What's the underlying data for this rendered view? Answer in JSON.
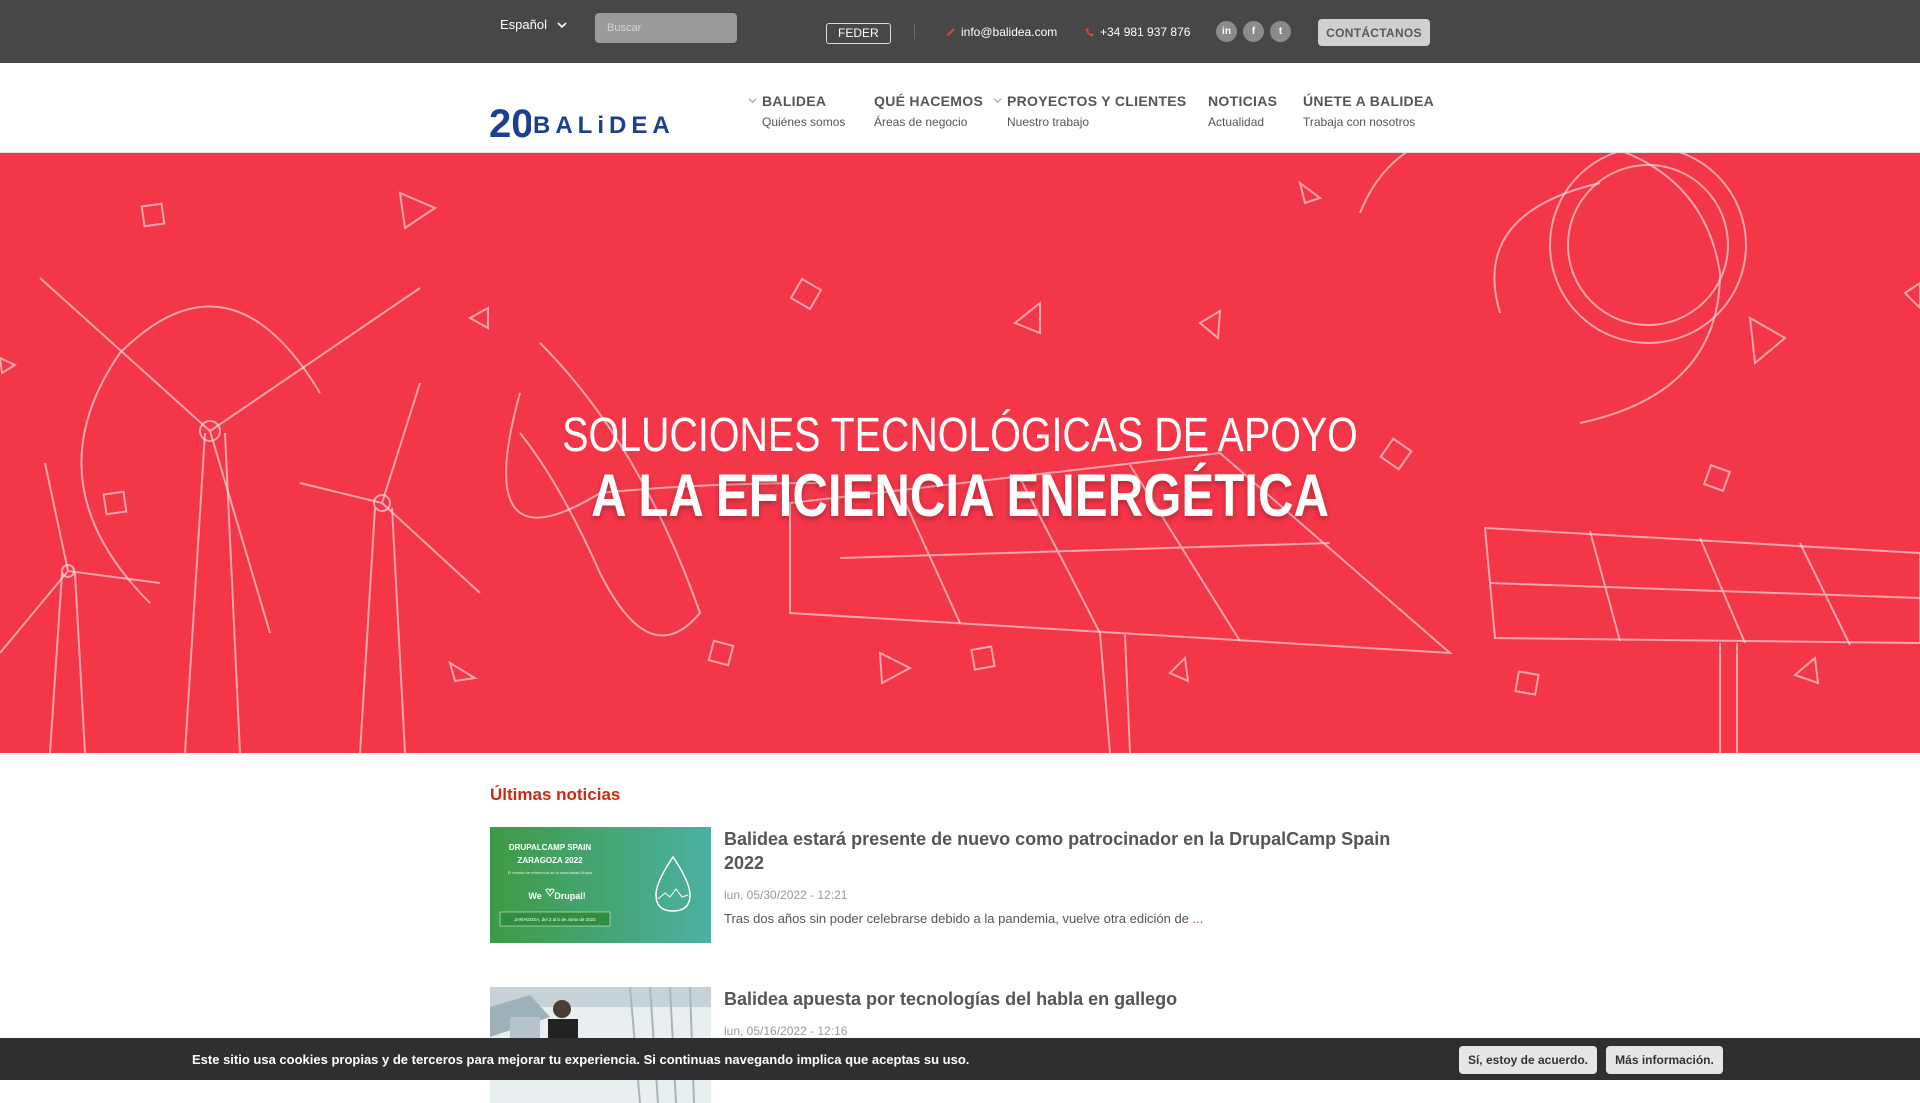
{
  "topbar": {
    "language": "Español",
    "search_placeholder": "Buscar",
    "feder_label": "FEDER",
    "email": "info@balidea.com",
    "phone": "+34 981 937 876",
    "social": [
      "in",
      "f",
      "t"
    ],
    "contact_button": "CONTÁCTANOS"
  },
  "header": {
    "logo_number": "20",
    "logo_word": "BALiDEA",
    "nav": [
      {
        "title": "BALIDEA",
        "subtitle": "Quiénes somos"
      },
      {
        "title": "QUÉ HACEMOS",
        "subtitle": "Áreas de negocio"
      },
      {
        "title": "PROYECTOS Y CLIENTES",
        "subtitle": "Nuestro trabajo"
      },
      {
        "title": "NOTICIAS",
        "subtitle": "Actualidad"
      },
      {
        "title": "ÚNETE A BALIDEA",
        "subtitle": "Trabaja con nosotros"
      }
    ]
  },
  "hero": {
    "line1": "SOLUCIONES TECNOLÓGICAS DE APOYO",
    "line2": "A LA EFICIENCIA ENERGÉTICA"
  },
  "news": {
    "section_title": "Últimas noticias",
    "items": [
      {
        "title": "Balidea estará presente de nuevo como patrocinador en la DrupalCamp Spain 2022",
        "date": "lun, 05/30/2022 - 12:21",
        "excerpt": "Tras dos años sin poder celebrarse debido a la pandemia, vuelve otra edición de ",
        "more": "...",
        "thumb": {
          "line1": "DRUPALCAMP SPAIN",
          "line2": "ZARAGOZA 2022",
          "line3": "El evento de referencia de la comunidad Drupal",
          "we": "We",
          "drupal": "Drupal!",
          "footer": "ZARAGOZA, del 3 al 5 de Junio de 2022"
        }
      },
      {
        "title": "Balidea apuesta por tecnologías del habla en gallego",
        "date": "lun, 05/16/2022 - 12:16"
      }
    ]
  },
  "cookie": {
    "message": "Este sitio usa cookies propias y de terceros para mejorar tu experiencia. Si continuas navegando implica que aceptas su uso.",
    "accept": "Sí, estoy de acuerdo.",
    "more": "Más información."
  },
  "colors": {
    "hero": "#f33648",
    "accent": "#cc2b12",
    "topbar": "#474747",
    "brand_blue": "#1d3f8f"
  }
}
